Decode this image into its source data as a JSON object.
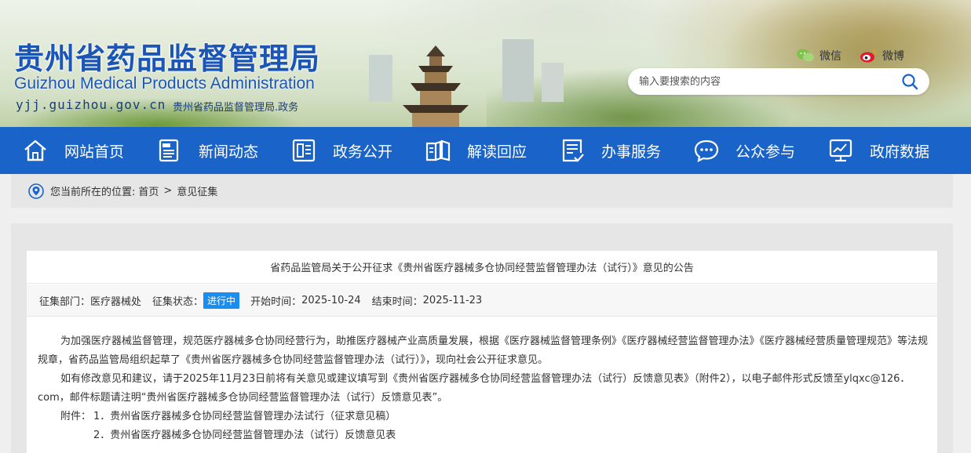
{
  "header": {
    "site_name_cn": "贵州省药品监督管理局",
    "site_name_en": "Guizhou Medical Products Administration",
    "domain": "yjj.guizhou.gov.cn",
    "domain_tag": "贵州省药品监督管理局.政务",
    "social": {
      "wechat_label": "微信",
      "weibo_label": "微博"
    },
    "search": {
      "placeholder": "输入要搜索的内容"
    }
  },
  "nav": {
    "items": [
      {
        "label": "网站首页",
        "icon": "home-icon"
      },
      {
        "label": "新闻动态",
        "icon": "news-icon"
      },
      {
        "label": "政务公开",
        "icon": "document-icon"
      },
      {
        "label": "解读回应",
        "icon": "book-icon"
      },
      {
        "label": "办事服务",
        "icon": "service-form-icon"
      },
      {
        "label": "公众参与",
        "icon": "chat-icon"
      },
      {
        "label": "政府数据",
        "icon": "chart-monitor-icon"
      }
    ]
  },
  "breadcrumb": {
    "prefix": "您当前所在的位置:",
    "home": "首页",
    "separator": ">",
    "current": "意见征集"
  },
  "article": {
    "title": "省药品监管局关于公开征求《贵州省医疗器械多仓协同经营监督管理办法（试行）》意见的公告",
    "meta": {
      "dept_label": "征集部门：",
      "dept_value": "医疗器械处",
      "status_label": "征集状态：",
      "status_value": "进行中",
      "start_label": "开始时间：",
      "start_value": "2025-10-24",
      "end_label": "结束时间：",
      "end_value": "2025-11-23"
    },
    "paragraphs": [
      "为加强医疗器械监督管理，规范医疗器械多仓协同经营行为，助推医疗器械产业高质量发展，根据《医疗器械监督管理条例》《医疗器械经营监督管理办法》《医疗器械经营质量管理规范》等法规规章，省药品监管局组织起草了《贵州省医疗器械多仓协同经营监督管理办法（试行）》，现向社会公开征求意见。",
      "如有修改意见和建议，请于2025年11月23日前将有关意见或建议填写到《贵州省医疗器械多仓协同经营监督管理办法（试行）反馈意见表》（附件2），以电子邮件形式反馈至ylqxc@126．com，邮件标题请注明“贵州省医疗器械多仓协同经营监督管理办法（试行）反馈意见表”。"
    ],
    "attachments_label": "附件：",
    "attachments": [
      "1．贵州省医疗器械多仓协同经营监督管理办法试行（征求意见稿）",
      "2．贵州省医疗器械多仓协同经营监督管理办法（试行）反馈意见表"
    ]
  },
  "colors": {
    "nav_bg": "#1a63c8",
    "logo_blue": "#1b55b5",
    "badge_blue": "#1a8df0"
  }
}
